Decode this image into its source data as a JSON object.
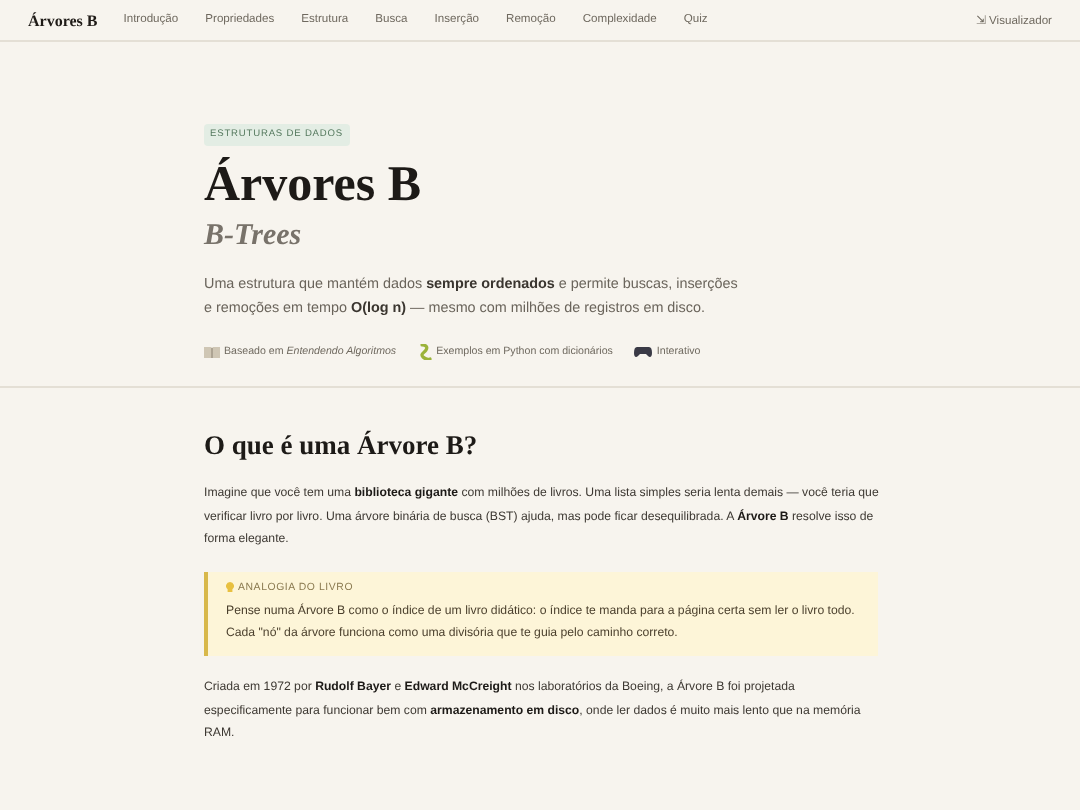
{
  "nav": {
    "brand": "Árvores B",
    "links": [
      "Introdução",
      "Propriedades",
      "Estrutura",
      "Busca",
      "Inserção",
      "Remoção",
      "Complexidade",
      "Quiz"
    ],
    "action": {
      "icon": "⇲",
      "label": "Visualizador"
    }
  },
  "hero": {
    "tag": "ESTRUTURAS DE DADOS",
    "title": "Árvores B",
    "subtitle": "B-Trees",
    "lead": "Uma estrutura que mantém dados **sempre ordenados** e permite buscas, inserções e remoções em tempo **O(log n)** — mesmo com milhões de registros em disco.",
    "meta": [
      {
        "kind": "book",
        "text": "Baseado em *Entendendo Algoritmos*"
      },
      {
        "kind": "snake",
        "text": "Exemplos em Python com dicionários"
      },
      {
        "kind": "gamepad",
        "text": "Interativo"
      }
    ]
  },
  "section": {
    "heading": "O que é uma Árvore B?",
    "intro": "Imagine que você tem uma **biblioteca gigante** com milhões de livros. Uma lista simples seria lenta demais — você teria que verificar livro por livro. Uma árvore binária de busca (BST) ajuda, mas pode ficar desequilibrada. A **Árvore B** resolve isso de forma elegante.",
    "callout": {
      "label": "ANALOGIA DO LIVRO",
      "text": "Pense numa Árvore B como o índice de um livro didático: o índice te manda para a página certa sem ler o livro todo. Cada \"nó\" da árvore funciona como uma divisória que te guia pelo caminho correto."
    },
    "history": "Criada em 1972 por **Rudolf Bayer** e **Edward McCreight** nos laboratórios da Boeing, a Árvore B foi projetada especificamente para funcionar bem com **armazenamento em disco**, onde ler dados é muito mais lento que na memória RAM."
  }
}
